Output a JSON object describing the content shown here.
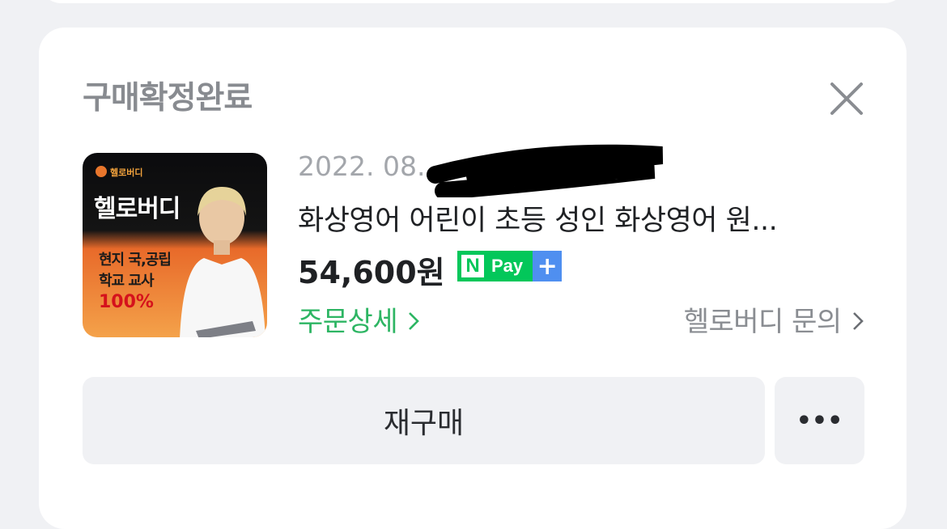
{
  "card": {
    "status": "구매확정완료",
    "order_date": "2022. 08.",
    "product_name": "화상영어 어린이 초등 성인 화상영어 원...",
    "price": "54,600원",
    "npay": {
      "n": "N",
      "label": "Pay",
      "plus": "+"
    },
    "order_detail_link": "주문상세",
    "seller_inquiry_link": "헬로버디 문의",
    "rebuy_button": "재구매",
    "more_button": "•••"
  },
  "thumbnail": {
    "logo_text": "헬로버디",
    "brand": "헬로버디",
    "line1": "현지 국,공립",
    "line2": "학교 교사",
    "percent": "100%"
  },
  "colors": {
    "accent_green": "#2db563",
    "npay_green": "#03c75a",
    "npay_blue": "#4f8ff0",
    "muted_text": "#888b90",
    "background": "#f0f1f4"
  }
}
